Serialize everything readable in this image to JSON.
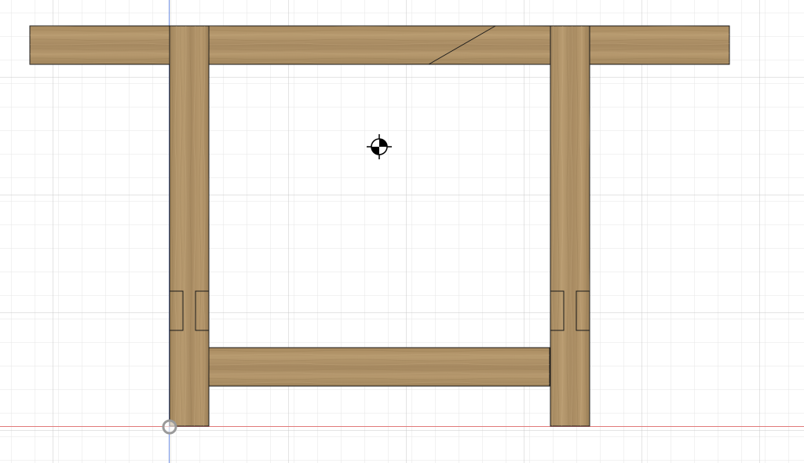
{
  "app": {
    "view": "front-orthographic",
    "colors": {
      "background": "#ffffff",
      "grid_minor": "#e6e6e6",
      "grid_major": "#c8c8c8",
      "axis_vertical": "#6f8fe0",
      "axis_horizontal": "#e07a7a",
      "wood_light": "#b99b70",
      "wood_mid": "#a4875d",
      "wood_dark": "#8d714b",
      "edge": "#1a1a1a"
    }
  },
  "model": {
    "name": "wooden-frame",
    "parts": [
      {
        "name": "top-rail",
        "kind": "horizontal-board"
      },
      {
        "name": "left-leg",
        "kind": "vertical-post"
      },
      {
        "name": "right-leg",
        "kind": "vertical-post"
      },
      {
        "name": "bottom-stretcher",
        "kind": "horizontal-board"
      }
    ],
    "features": [
      {
        "name": "scarf-joint",
        "part": "top-rail"
      },
      {
        "name": "left-mortise-outer",
        "part": "left-leg"
      },
      {
        "name": "left-mortise-inner",
        "part": "left-leg"
      },
      {
        "name": "right-mortise-outer",
        "part": "right-leg"
      },
      {
        "name": "right-mortise-inner",
        "part": "right-leg"
      }
    ]
  },
  "markers": {
    "center_of_mass": "center-of-mass-icon",
    "origin": "origin-marker-icon"
  }
}
